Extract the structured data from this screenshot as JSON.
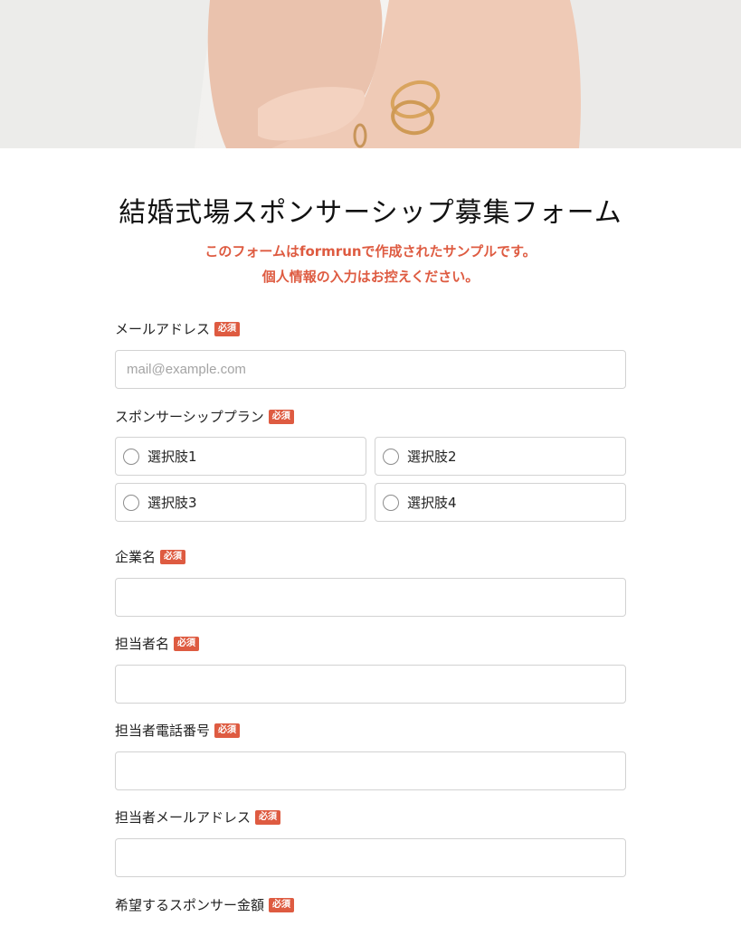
{
  "form": {
    "title": "結婚式場スポンサーシップ募集フォーム",
    "notice_line1": "このフォームはformrunで作成されたサンプルです。",
    "notice_line2": "個人情報の入力はお控えください。",
    "required_badge": "必須"
  },
  "hero": {
    "image_subject": "hands-holding-wedding-rings"
  },
  "fields": {
    "email": {
      "label": "メールアドレス",
      "placeholder": "mail@example.com",
      "value": ""
    },
    "sponsorship_plan": {
      "label": "スポンサーシッププラン",
      "options": [
        "選択肢1",
        "選択肢2",
        "選択肢3",
        "選択肢4"
      ]
    },
    "company_name": {
      "label": "企業名",
      "value": ""
    },
    "contact_name": {
      "label": "担当者名",
      "value": ""
    },
    "contact_phone": {
      "label": "担当者電話番号",
      "value": ""
    },
    "contact_email": {
      "label": "担当者メールアドレス",
      "value": ""
    },
    "sponsor_amount": {
      "label": "希望するスポンサー金額"
    }
  },
  "colors": {
    "accent": "#de5b41",
    "input_border": "#d2d2d2",
    "placeholder": "#a4a4a4"
  }
}
